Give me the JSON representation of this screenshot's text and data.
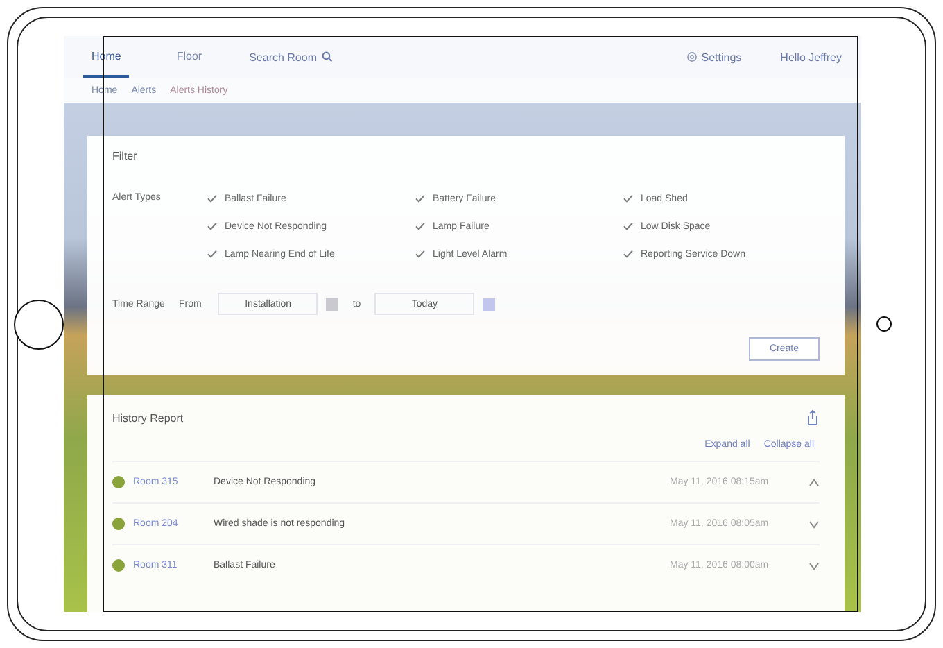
{
  "nav": {
    "items": [
      {
        "label": "Home",
        "selected": true
      },
      {
        "label": "Floor",
        "selected": false
      }
    ],
    "search": "Search Room",
    "settings": "Settings",
    "user": "Hello Jeffrey"
  },
  "breadcrumb": [
    "Home",
    "Alerts",
    "Alerts History"
  ],
  "filter": {
    "title": "Filter",
    "alert_types_label": "Alert Types",
    "options": [
      {
        "label": "Ballast Failure",
        "checked": true
      },
      {
        "label": "Battery Failure",
        "checked": true
      },
      {
        "label": "Load Shed",
        "checked": true
      },
      {
        "label": "Device Not Responding",
        "checked": true
      },
      {
        "label": "Lamp Failure",
        "checked": true
      },
      {
        "label": "Low Disk Space",
        "checked": true
      },
      {
        "label": "Lamp Nearing End of Life",
        "checked": true
      },
      {
        "label": "Light Level Alarm",
        "checked": true
      },
      {
        "label": "Reporting Service Down",
        "checked": true
      }
    ],
    "time_range_label": "Time Range",
    "from_label": "From",
    "from_value": "Installation",
    "to_label": "to",
    "to_value": "Today",
    "create": "Create"
  },
  "history": {
    "title": "History Report",
    "expand_all": "Expand all",
    "collapse_all": "Collapse all",
    "rows": [
      {
        "room": "Room 315",
        "description": "Device Not Responding",
        "time": "May 11, 2016 08:15am",
        "expanded": true
      },
      {
        "room": "Room 204",
        "description": "Wired shade is not responding",
        "time": "May 11, 2016 08:05am",
        "expanded": false
      },
      {
        "room": "Room 311",
        "description": "Ballast Failure",
        "time": "May 11, 2016 08:00am",
        "expanded": false
      }
    ]
  }
}
